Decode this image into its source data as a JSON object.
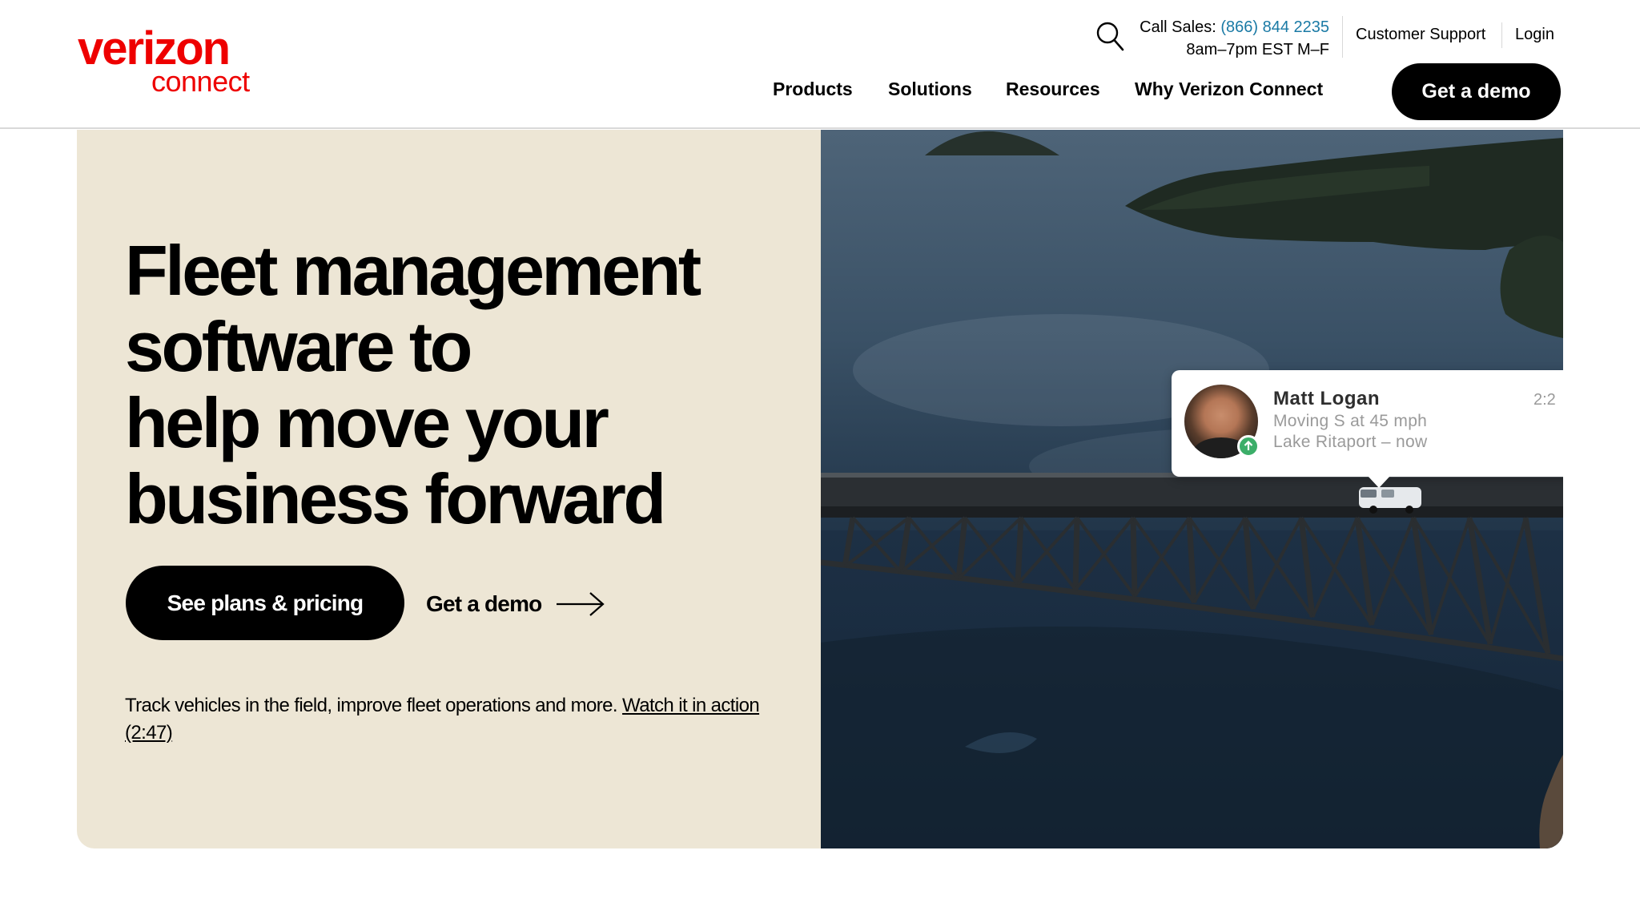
{
  "brand": {
    "logo_word": "verizon",
    "logo_sub": "connect",
    "brand_color": "#ee0000"
  },
  "header": {
    "search_icon": "search-icon",
    "call_sales_label": "Call Sales:",
    "call_sales_phone": "(866) 844 2235",
    "call_sales_hours": "8am–7pm EST M–F",
    "customer_support": "Customer Support",
    "login": "Login",
    "nav": [
      "Products",
      "Solutions",
      "Resources",
      "Why Verizon Connect"
    ],
    "cta": "Get a demo",
    "phone_color": "#1a7aa5"
  },
  "hero": {
    "title_lines": [
      "Fleet management",
      "software to",
      "help move your",
      "business forward"
    ],
    "primary_cta": "See plans & pricing",
    "secondary_cta": "Get a demo",
    "secondary_cta_icon": "arrow-right-icon",
    "description": "Track vehicles in the field, improve fleet operations and more.",
    "watch_link": "Watch it in action (2:47)",
    "background_color": "#ede6d5"
  },
  "driver_card": {
    "name": "Matt Logan",
    "status": "Moving S at 45 mph",
    "location": "Lake Ritaport – now",
    "time": "2:2",
    "status_icon": "arrow-up-icon",
    "status_color": "#3cae69"
  }
}
